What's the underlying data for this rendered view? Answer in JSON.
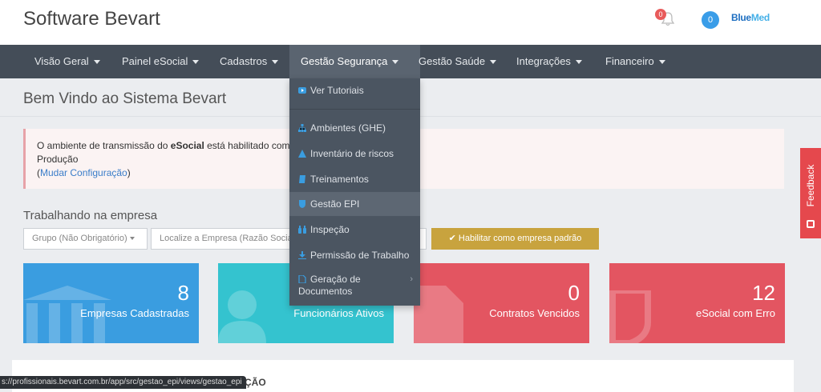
{
  "header": {
    "brand": "Software Bevart",
    "notifications_count": "0",
    "user_badge": "0",
    "partner_logo_main": "Blue",
    "partner_logo_accent": "Med"
  },
  "nav": {
    "items": [
      {
        "label": "Visão Geral"
      },
      {
        "label": "Painel eSocial"
      },
      {
        "label": "Cadastros"
      },
      {
        "label": "Gestão Segurança"
      },
      {
        "label": "Gestão Saúde"
      },
      {
        "label": "Integrações"
      },
      {
        "label": "Financeiro"
      }
    ],
    "active_index": 3
  },
  "dropdown": {
    "items": [
      {
        "label": "Ver Tutoriais",
        "icon": "youtube-icon"
      },
      {
        "label": "Ambientes (GHE)",
        "icon": "sitemap-icon"
      },
      {
        "label": "Inventário de riscos",
        "icon": "warning-icon"
      },
      {
        "label": "Treinamentos",
        "icon": "book-icon"
      },
      {
        "label": "Gestão EPI",
        "icon": "shield-icon"
      },
      {
        "label": "Inspeção",
        "icon": "binoculars-icon"
      },
      {
        "label": "Permissão de Trabalho",
        "icon": "download-icon"
      },
      {
        "label": "Geração de Documentos",
        "label_line1": "Geração de",
        "label_line2": "Documentos",
        "icon": "file-icon"
      }
    ],
    "highlighted_index": 4
  },
  "page": {
    "title": "Bem Vindo ao Sistema Bevart"
  },
  "alert": {
    "text_before": "O ambiente de transmissão do ",
    "text_bold": "eSocial",
    "text_after": " está habilitado como:",
    "environment": "Produção",
    "paren_open": "(",
    "link": "Mudar Configuração",
    "paren_close": ")"
  },
  "empresa": {
    "label": "Trabalhando na empresa",
    "group_placeholder": "Grupo (Não Obrigatório)",
    "search_placeholder": "Localize a Empresa (Razão Social",
    "default_button": "Habilitar como empresa padrão"
  },
  "cards": [
    {
      "value": "8",
      "label": "Empresas Cadastradas",
      "color": "#3a9de0"
    },
    {
      "value": "",
      "label": "Funcionários Ativos",
      "color": "#34c3cf"
    },
    {
      "value": "0",
      "label": "Contratos Vencidos",
      "color": "#e35561"
    },
    {
      "value": "12",
      "label": "eSocial com Erro",
      "color": "#e35561"
    }
  ],
  "bottom": {
    "section_title_fragment": "ÇÃO"
  },
  "status_bar": {
    "url": "s://profissionais.bevart.com.br/app/src/gestao_epi/views/gestao_epi"
  },
  "feedback": {
    "label": "Feedback"
  },
  "colors": {
    "nav_bg": "#444d58",
    "dropdown_bg": "#4b5561",
    "accent_gold": "#c8a33e",
    "blue": "#3a9de0",
    "teal": "#34c3cf",
    "red": "#e35561"
  }
}
